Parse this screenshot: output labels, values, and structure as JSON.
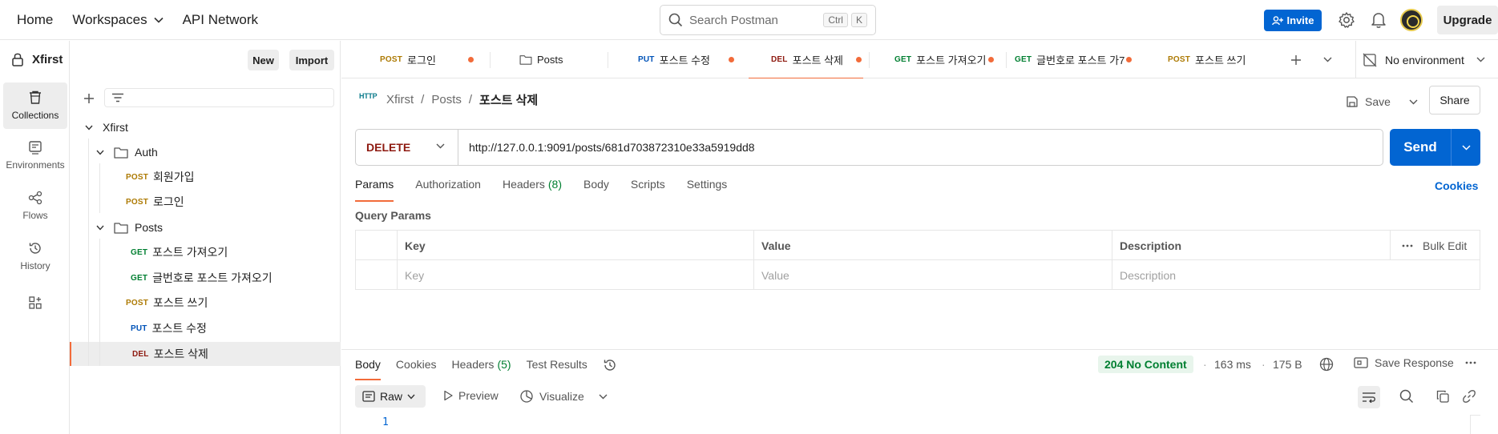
{
  "topbar": {
    "home": "Home",
    "workspaces": "Workspaces",
    "api_network": "API Network",
    "search_placeholder": "Search Postman",
    "kbd_ctrl": "Ctrl",
    "kbd_k": "K",
    "invite": "Invite",
    "upgrade": "Upgrade"
  },
  "rail": {
    "collections": "Collections",
    "environments": "Environments",
    "flows": "Flows",
    "history": "History"
  },
  "sidebar": {
    "workspace_name": "Xfirst",
    "new_label": "New",
    "import_label": "Import",
    "collection": "Xfirst",
    "folder_auth": "Auth",
    "folder_posts": "Posts",
    "items": [
      {
        "method": "POST",
        "name": "회원가입"
      },
      {
        "method": "POST",
        "name": "로그인"
      },
      {
        "method": "GET",
        "name": "포스트 가져오기"
      },
      {
        "method": "GET",
        "name": "글번호로 포스트 가져오기"
      },
      {
        "method": "POST",
        "name": "포스트 쓰기"
      },
      {
        "method": "PUT",
        "name": "포스트 수정"
      },
      {
        "method": "DEL",
        "name": "포스트 삭제"
      }
    ]
  },
  "tabs": [
    {
      "method": "POST",
      "name": "로그인"
    },
    {
      "method": "",
      "name": "Posts"
    },
    {
      "method": "PUT",
      "name": "포스트 수정"
    },
    {
      "method": "DEL",
      "name": "포스트 삭제"
    },
    {
      "method": "GET",
      "name": "포스트 가져오기"
    },
    {
      "method": "GET",
      "name": "글번호로 포스트 가7"
    },
    {
      "method": "POST",
      "name": "포스트 쓰기"
    }
  ],
  "environment": "No environment",
  "request": {
    "http_badge": "HTTP",
    "breadcrumb": [
      "Xfirst",
      "Posts",
      "포스트 삭제"
    ],
    "breadcrumb_sep": "/",
    "save_label": "Save",
    "share_label": "Share",
    "method": "DELETE",
    "url": "http://127.0.0.1:9091/posts/681d703872310e33a5919dd8",
    "send_label": "Send",
    "tabs": {
      "params": "Params",
      "authorization": "Authorization",
      "headers": "Headers",
      "headers_count": "(8)",
      "body": "Body",
      "scripts": "Scripts",
      "settings": "Settings"
    },
    "cookies": "Cookies",
    "query_params_title": "Query Params",
    "table": {
      "col_key": "Key",
      "col_value": "Value",
      "col_description": "Description",
      "bulk_edit": "Bulk Edit",
      "ph_key": "Key",
      "ph_value": "Value",
      "ph_description": "Description"
    }
  },
  "response": {
    "tabs": {
      "body": "Body",
      "cookies": "Cookies",
      "headers": "Headers",
      "headers_count": "(5)",
      "test_results": "Test Results"
    },
    "status": "204 No Content",
    "time": "163 ms",
    "size": "175 B",
    "meta_sep": "·",
    "save_response": "Save Response",
    "format": "Raw",
    "preview": "Preview",
    "visualize": "Visualize",
    "line_number": "1"
  },
  "colors": {
    "accent": "#f26b3a",
    "primary": "#0265d2",
    "post": "#ad7a03",
    "get": "#007f31",
    "put": "#0053b8",
    "delete": "#8e1a10"
  }
}
